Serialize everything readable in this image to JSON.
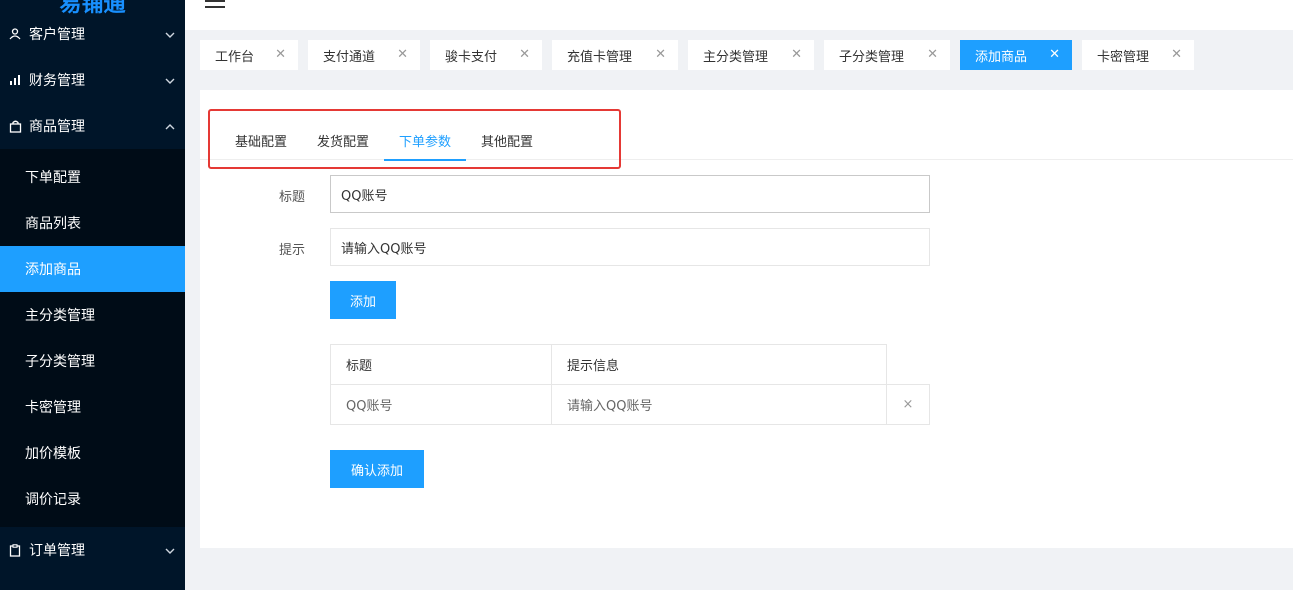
{
  "app": {
    "logo_text": "易铺通"
  },
  "sidebar": {
    "top_items": [
      {
        "label": "客户管理",
        "icon": "user-icon"
      },
      {
        "label": "财务管理",
        "icon": "bar-chart-icon"
      },
      {
        "label": "商品管理",
        "icon": "bag-icon"
      }
    ],
    "sub_items": [
      {
        "label": "下单配置"
      },
      {
        "label": "商品列表"
      },
      {
        "label": "添加商品"
      },
      {
        "label": "主分类管理"
      },
      {
        "label": "子分类管理"
      },
      {
        "label": "卡密管理"
      },
      {
        "label": "加价模板"
      },
      {
        "label": "调价记录"
      }
    ],
    "bottom_item": {
      "label": "订单管理",
      "icon": "clipboard-icon"
    },
    "active_sub": "添加商品"
  },
  "tabs": [
    {
      "label": "工作台"
    },
    {
      "label": "支付通道"
    },
    {
      "label": "骏卡支付"
    },
    {
      "label": "充值卡管理"
    },
    {
      "label": "主分类管理"
    },
    {
      "label": "子分类管理"
    },
    {
      "label": "添加商品"
    },
    {
      "label": "卡密管理"
    }
  ],
  "active_tab": "添加商品",
  "form": {
    "inner_tabs": [
      {
        "label": "基础配置"
      },
      {
        "label": "发货配置"
      },
      {
        "label": "下单参数"
      },
      {
        "label": "其他配置"
      }
    ],
    "active_inner_tab": "下单参数",
    "title_label": "标题",
    "title_value": "QQ账号",
    "hint_label": "提示",
    "hint_value": "请输入QQ账号",
    "add_button": "添加",
    "table": {
      "headers": [
        "标题",
        "提示信息"
      ],
      "rows": [
        {
          "title": "QQ账号",
          "hint": "请输入QQ账号",
          "remove": "×"
        }
      ]
    },
    "confirm_button": "确认添加"
  },
  "colors": {
    "accent": "#1e9fff",
    "sidebar_bg": "#001529",
    "highlight_border": "#e53935"
  }
}
